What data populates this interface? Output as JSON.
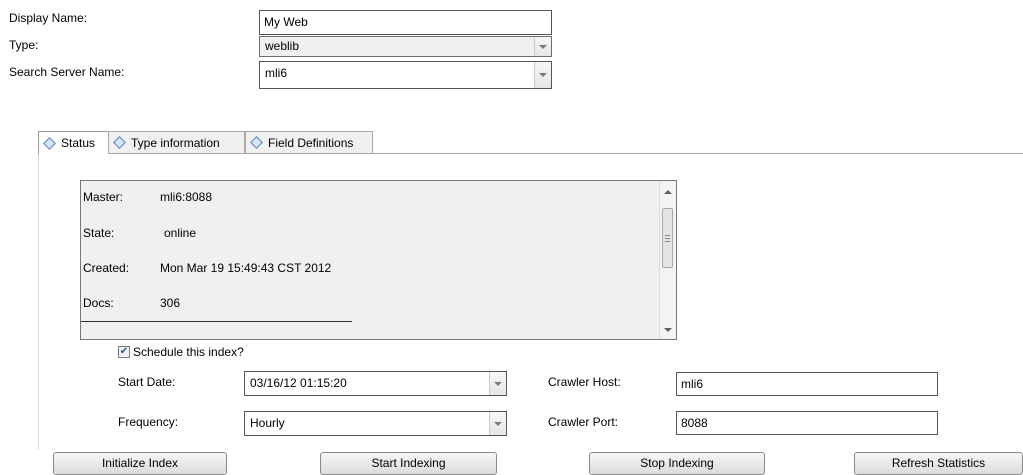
{
  "form": {
    "display_name_label": "Display Name:",
    "display_name_value": "My Web",
    "type_label": "Type:",
    "type_value": "weblib",
    "search_server_label": "Search Server Name:",
    "search_server_value": "mli6"
  },
  "tabs": [
    {
      "label": "Status",
      "active": true,
      "icon": "diamond-icon"
    },
    {
      "label": "Type information",
      "active": false,
      "icon": "diamond-icon"
    },
    {
      "label": "Field Definitions",
      "active": false,
      "icon": "diamond-icon"
    }
  ],
  "status": {
    "master_label": "Master:",
    "master_value": "mli6:8088",
    "state_label": "State:",
    "state_value": "online",
    "created_label": "Created:",
    "created_value": "Mon Mar 19 15:49:43 CST 2012",
    "docs_label": "Docs:",
    "docs_value": "306"
  },
  "schedule": {
    "checkbox_label": "Schedule this index?",
    "checked": true,
    "start_date_label": "Start Date:",
    "start_date_value": "03/16/12 01:15:20",
    "frequency_label": "Frequency:",
    "frequency_value": "Hourly",
    "crawler_host_label": "Crawler Host:",
    "crawler_host_value": "mli6",
    "crawler_port_label": "Crawler Port:",
    "crawler_port_value": "8088"
  },
  "buttons": {
    "initialize": "Initialize Index",
    "start": "Start Indexing",
    "stop": "Stop Indexing",
    "refresh": "Refresh Statistics"
  }
}
